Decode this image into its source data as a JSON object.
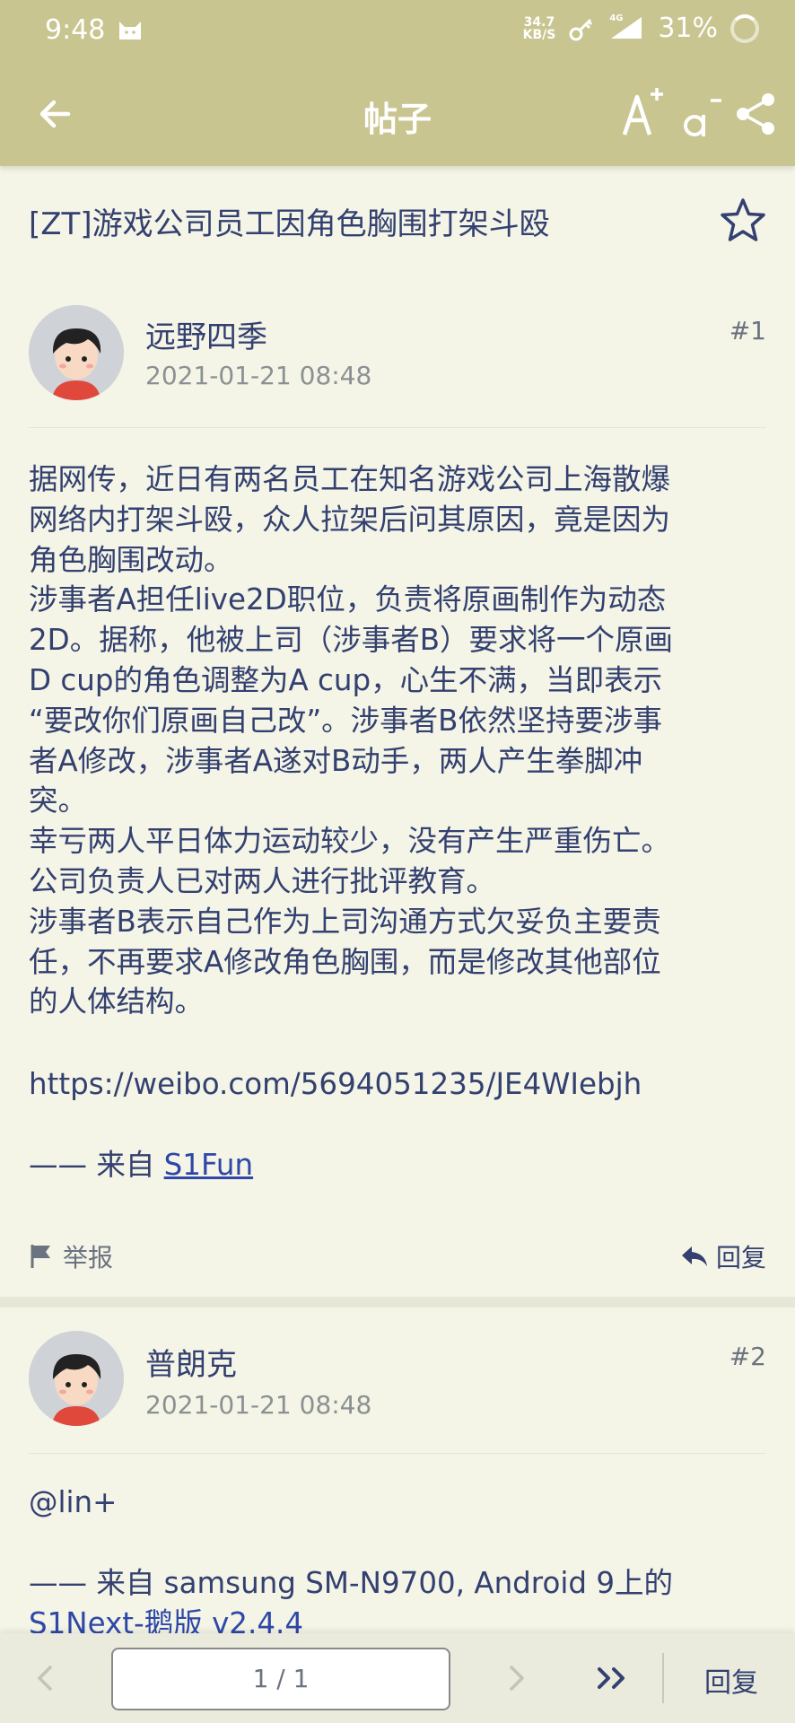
{
  "status_bar": {
    "time": "9:48",
    "net_speed_value": "34.7",
    "net_speed_unit": "KB/S",
    "network_label": "4G",
    "battery": "31%",
    "icons": [
      "cat-icon",
      "key-icon",
      "signal-icon",
      "battery-ring-icon"
    ]
  },
  "appbar": {
    "title": "帖子",
    "icons": [
      "back-arrow-icon",
      "font-increase-icon",
      "font-decrease-icon",
      "share-icon"
    ]
  },
  "thread": {
    "title": "[ZT]游戏公司员工因角色胸围打架斗殴",
    "favorite_icon": "star-outline-icon"
  },
  "posts": [
    {
      "author": "远野四季",
      "date": "2021-01-21 08:48",
      "floor": "#1",
      "body": "据网传，近日有两名员工在知名游戏公司上海散爆\n网络内打架斗殴，众人拉架后问其原因，竟是因为\n角色胸围改动。\n涉事者A担任live2D职位，负责将原画制作为动态\n2D。据称，他被上司（涉事者B）要求将一个原画\nD cup的角色调整为A cup，心生不满，当即表示\n“要改你们原画自己改”。涉事者B依然坚持要涉事\n者A修改，涉事者A遂对B动手，两人产生拳脚冲\n突。\n幸亏两人平日体力运动较少，没有产生严重伤亡。\n公司负责人已对两人进行批评教育。\n涉事者B表示自己作为上司沟通方式欠妥负主要责\n任，不再要求A修改角色胸围，而是修改其他部位\n的人体结构。",
      "url": "https://weibo.com/5694051235/JE4WIebjh",
      "signature_prefix": "—— 来自 ",
      "signature_link": "S1Fun",
      "report_label": "举报",
      "reply_label": "回复"
    },
    {
      "author": "普朗克",
      "date": "2021-01-21 08:48",
      "floor": "#2",
      "body": "@lin+",
      "signature_prefix": "—— 来自 samsung SM-N9700, Android 9上的",
      "signature_link": "S1Next-鹅版 v2.4.4"
    }
  ],
  "pager": {
    "page_display": "1 / 1",
    "reply_label": "回复",
    "icons": [
      "prev-page-icon",
      "next-page-icon",
      "last-page-icon"
    ]
  }
}
